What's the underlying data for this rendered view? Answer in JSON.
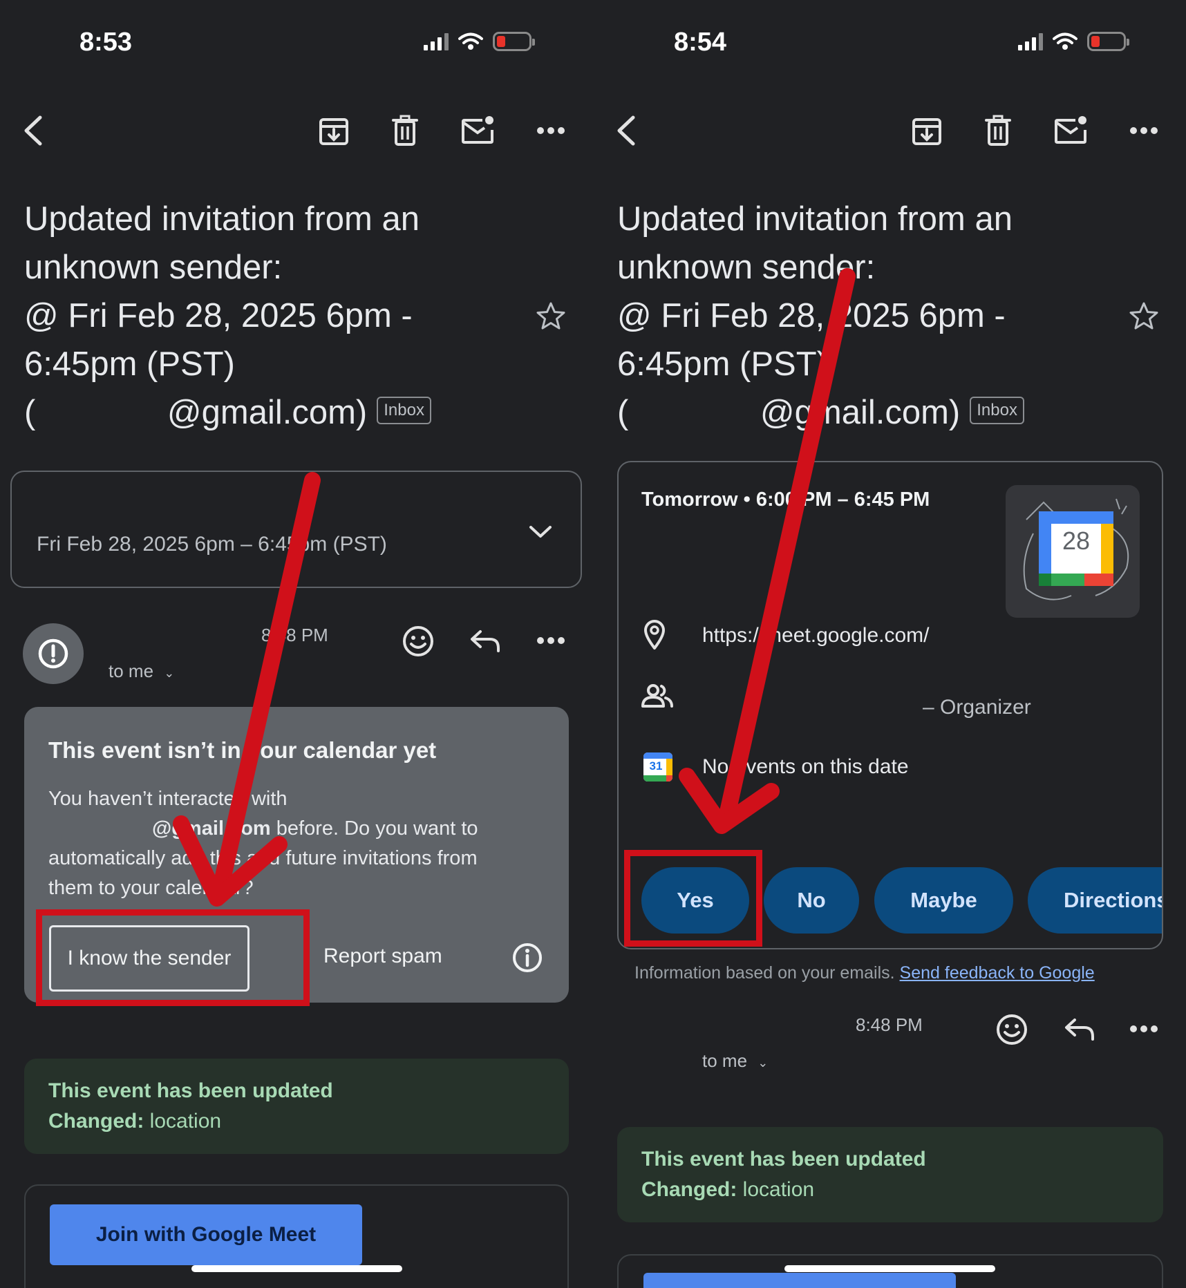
{
  "left": {
    "status": {
      "time": "8:53"
    },
    "subject": {
      "line1": "Updated invitation from an",
      "line2": "unknown sender:",
      "line3": "@ Fri Feb 28, 2025 6pm -",
      "line4": "6:45pm (PST)",
      "line5": "(              @gmail.com)",
      "chip": "Inbox"
    },
    "event_summary": "Fri Feb 28, 2025 6pm – 6:45pm (PST)",
    "message": {
      "time": "8:48 PM",
      "recipient": "to me"
    },
    "unknown_card": {
      "title": "This event isn’t in your calendar yet",
      "body_part1": "You haven’t interacted with",
      "sender": "@gmail.com",
      "body_part2": " before. Do you want to",
      "body_part3": "automatically add this and future invitations from",
      "body_part4": "them to your calendar?",
      "know_button": "I know the sender",
      "spam_button": "Report spam"
    },
    "updated": {
      "title": "This event has been updated",
      "changed_label": "Changed:",
      "changed_value": "location"
    },
    "meet_button": "Join with Google Meet"
  },
  "right": {
    "status": {
      "time": "8:54"
    },
    "subject": {
      "line1": "Updated invitation from an",
      "line2": "unknown sender:",
      "line3": "@ Fri Feb 28, 2025 6pm -",
      "line4": "6:45pm (PST)",
      "line5": "(              @gmail.com)",
      "chip": "Inbox"
    },
    "event_card": {
      "when": "Tomorrow • 6:00 PM – 6:45 PM",
      "calendar_day": "28",
      "location": "https://meet.google.com/",
      "organizer": "– Organizer",
      "calendar_app_day": "31",
      "events_note": "No events on this date",
      "rsvp": [
        "Yes",
        "No",
        "Maybe",
        "Directions"
      ]
    },
    "footnote": "Information based on your emails.",
    "feedback_link": "Send feedback to Google",
    "message": {
      "time": "8:48 PM",
      "recipient": "to me"
    },
    "updated": {
      "title": "This event has been updated",
      "changed_label": "Changed:",
      "changed_value": "location"
    }
  },
  "colors": {
    "background": "#202124",
    "annotation_red": "#d0101a",
    "meet_button": "#4f86ec",
    "rsvp_pill": "#0b4a7e",
    "updated_box": "#26322a"
  }
}
